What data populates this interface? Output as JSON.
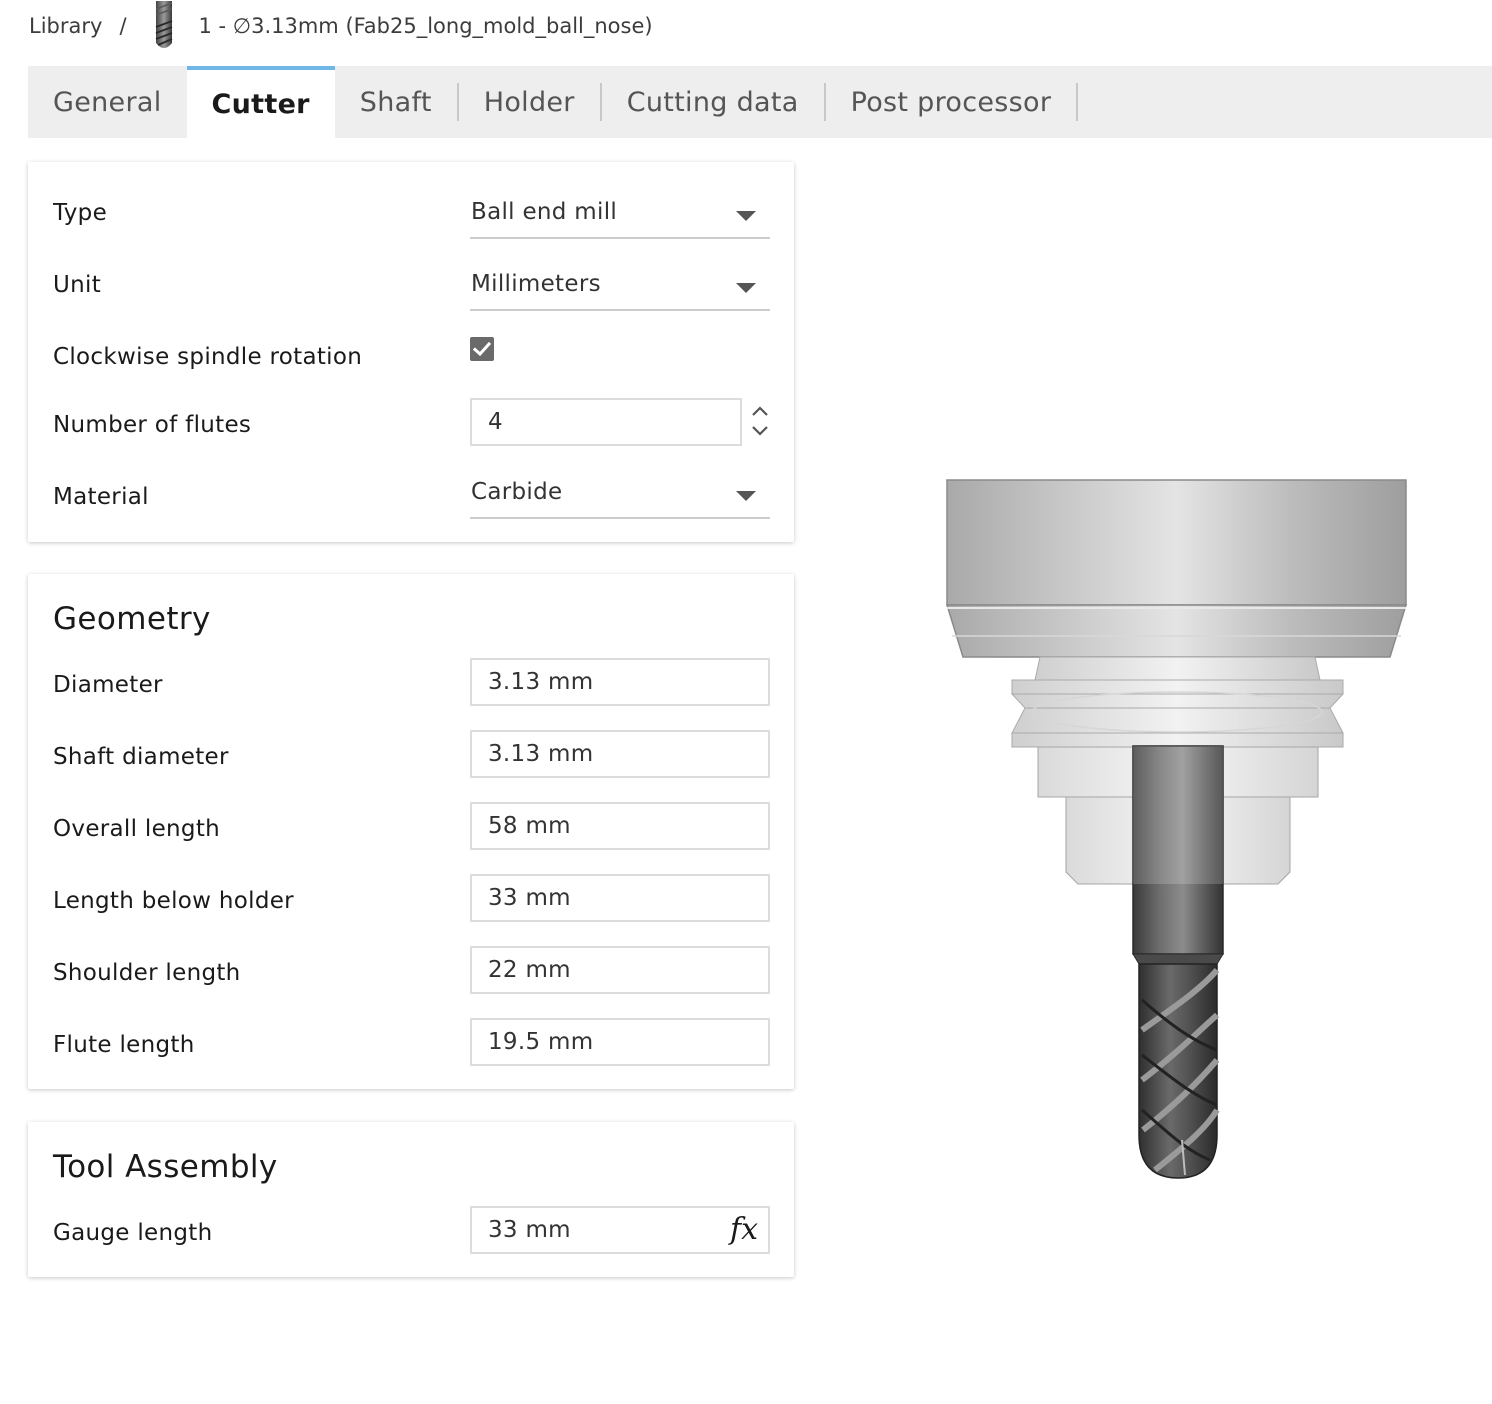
{
  "breadcrumb": {
    "root": "Library",
    "separator": "/",
    "current": "1 - ∅3.13mm (Fab25_long_mold_ball_nose)"
  },
  "tabs": [
    {
      "label": "General",
      "active": false
    },
    {
      "label": "Cutter",
      "active": true
    },
    {
      "label": "Shaft",
      "active": false
    },
    {
      "label": "Holder",
      "active": false
    },
    {
      "label": "Cutting data",
      "active": false
    },
    {
      "label": "Post processor",
      "active": false
    }
  ],
  "general": {
    "type": {
      "label": "Type",
      "value": "Ball end mill"
    },
    "unit": {
      "label": "Unit",
      "value": "Millimeters"
    },
    "clockwise": {
      "label": "Clockwise spindle rotation",
      "checked": true
    },
    "flutes": {
      "label": "Number of flutes",
      "value": "4"
    },
    "material": {
      "label": "Material",
      "value": "Carbide"
    }
  },
  "geometry": {
    "title": "Geometry",
    "diameter": {
      "label": "Diameter",
      "value": "3.13 mm"
    },
    "shaft_diameter": {
      "label": "Shaft diameter",
      "value": "3.13 mm"
    },
    "overall_length": {
      "label": "Overall length",
      "value": "58 mm"
    },
    "length_below_holder": {
      "label": "Length below holder",
      "value": "33 mm"
    },
    "shoulder_length": {
      "label": "Shoulder length",
      "value": "22 mm"
    },
    "flute_length": {
      "label": "Flute length",
      "value": "19.5 mm"
    }
  },
  "assembly": {
    "title": "Tool Assembly",
    "gauge_length": {
      "label": "Gauge length",
      "value": "33 mm"
    },
    "fx_label": "fx"
  },
  "icons": {
    "breadcrumb_thumb": "end-mill-thumbnail-icon",
    "dropdown": "caret-down-icon",
    "check": "checkmark-icon",
    "stepper_up": "chevron-up-icon",
    "stepper_down": "chevron-down-icon",
    "formula": "fx-formula-icon"
  },
  "colors": {
    "accent_tab": "#6fb7e6",
    "tab_bar_bg": "#eeeeee",
    "checkbox_bg": "#6a6a6a"
  }
}
